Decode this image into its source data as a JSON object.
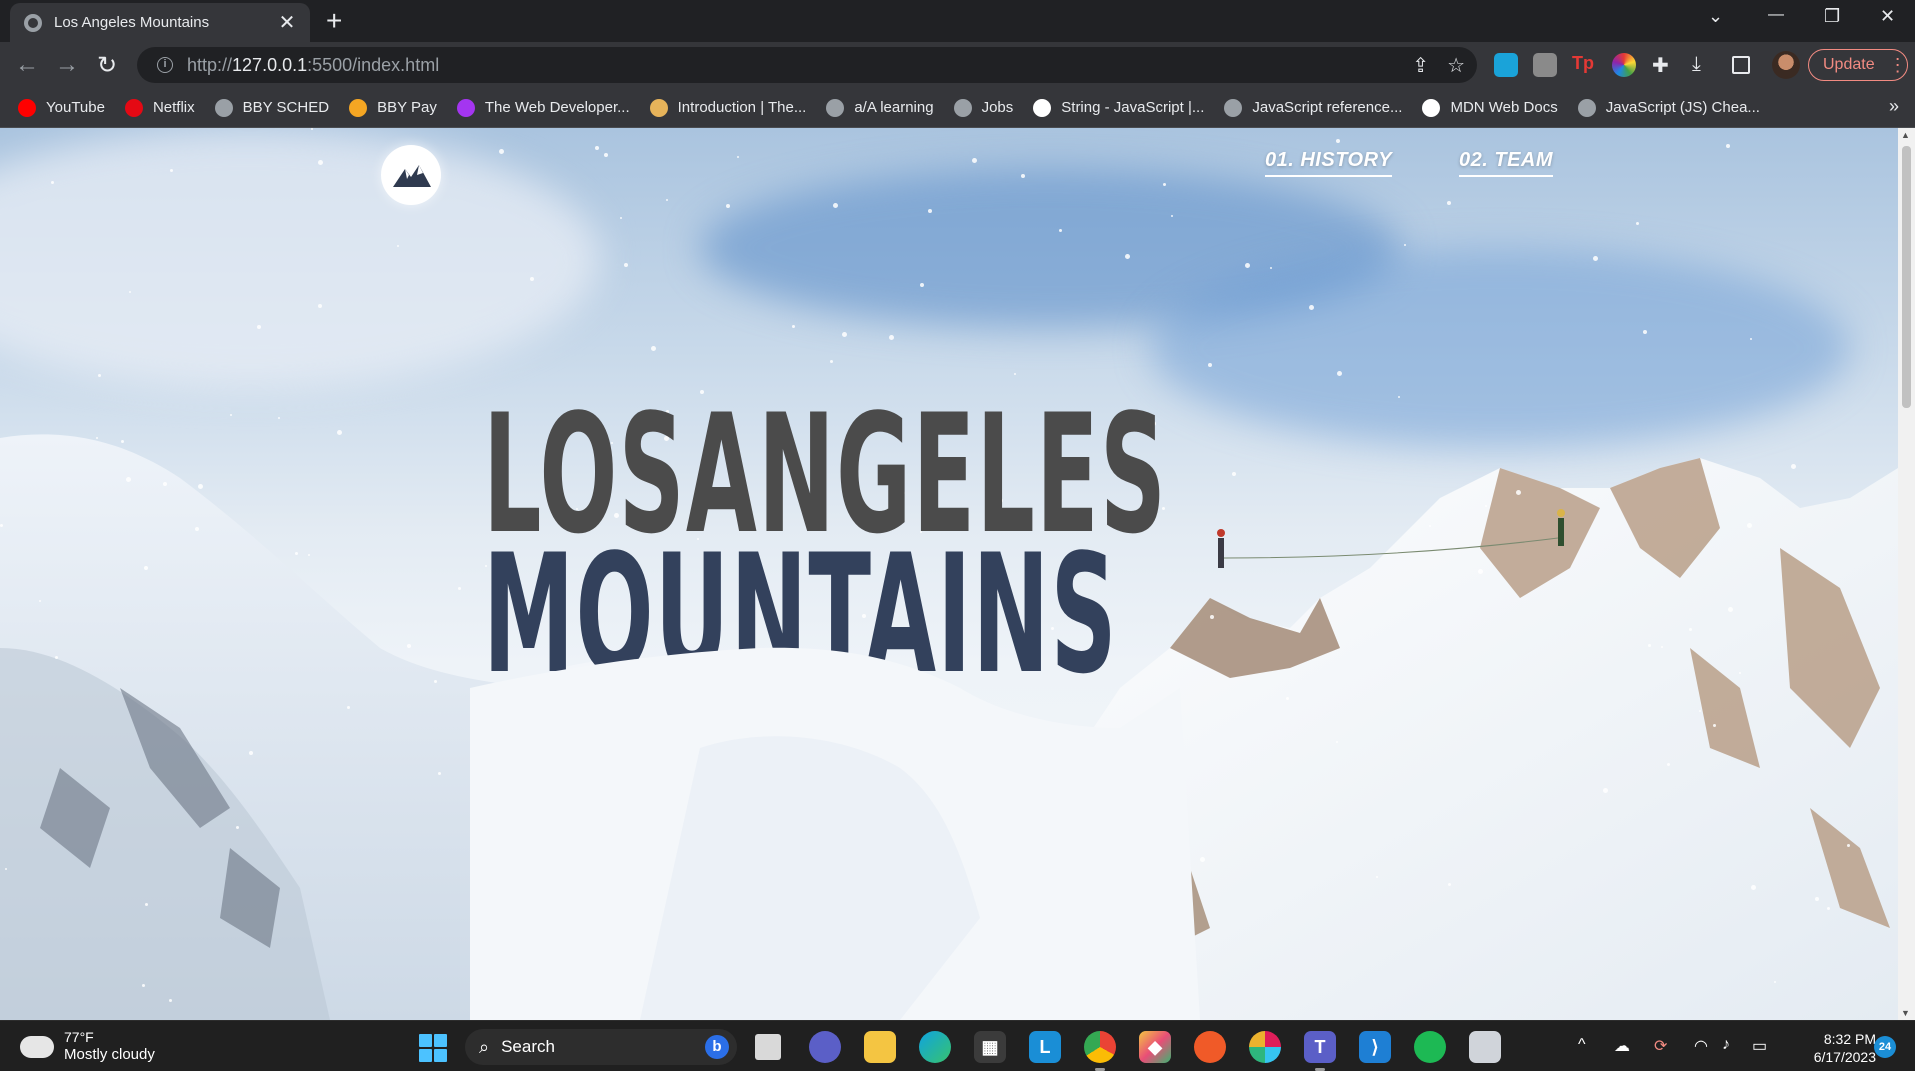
{
  "browser": {
    "tab": {
      "title": "Los Angeles Mountains",
      "close_glyph": "✕",
      "favicon": "globe-icon"
    },
    "new_tab_glyph": "+",
    "window_controls": {
      "tab_search": "⌄",
      "minimize": "—",
      "restore": "❐",
      "close": "✕"
    },
    "toolbar": {
      "back": "←",
      "forward": "→",
      "reload": "↻",
      "url_prefix": "http://",
      "url_host": "127.0.0.1",
      "url_rest": ":5500/index.html",
      "share_icon": "⇪",
      "star_icon": "☆",
      "update_label": "Update",
      "menu_glyph": "⋮"
    },
    "bookmarks": [
      {
        "label": "YouTube",
        "icon": "youtube-icon",
        "color": "#ff0000"
      },
      {
        "label": "Netflix",
        "icon": "netflix-icon",
        "color": "#e50914"
      },
      {
        "label": "BBY SCHED",
        "icon": "globe-icon",
        "color": "#9aa0a6"
      },
      {
        "label": "BBY Pay",
        "icon": "bby-pay-icon",
        "color": "#f5a623"
      },
      {
        "label": "The Web Developer...",
        "icon": "udemy-icon",
        "color": "#a435f0"
      },
      {
        "label": "Introduction | The...",
        "icon": "odin-icon",
        "color": "#e6b35a"
      },
      {
        "label": "a/A learning",
        "icon": "globe-icon",
        "color": "#9aa0a6"
      },
      {
        "label": "Jobs",
        "icon": "globe-icon",
        "color": "#9aa0a6"
      },
      {
        "label": "String - JavaScript |...",
        "icon": "mdn-icon",
        "color": "#ffffff"
      },
      {
        "label": "JavaScript reference...",
        "icon": "globe-icon",
        "color": "#9aa0a6"
      },
      {
        "label": "MDN Web Docs",
        "icon": "mdn-icon",
        "color": "#ffffff"
      },
      {
        "label": "JavaScript (JS) Chea...",
        "icon": "globe-icon",
        "color": "#9aa0a6"
      }
    ],
    "bookmarks_more": "»"
  },
  "page": {
    "nav": [
      {
        "label": "01. HISTORY"
      },
      {
        "label": "02. TEAM"
      }
    ],
    "hero": {
      "line1": "LOSANGELES",
      "line2": "MOUNTAINS"
    },
    "colors": {
      "line1": "#4b4b4b",
      "line2": "#33415c"
    }
  },
  "taskbar": {
    "weather": {
      "temp": "77°F",
      "condition": "Mostly cloudy"
    },
    "search_placeholder": "Search",
    "clock": {
      "time": "8:32 PM",
      "date": "6/17/2023"
    },
    "notification_count": "24",
    "tray_chevron": "^"
  }
}
